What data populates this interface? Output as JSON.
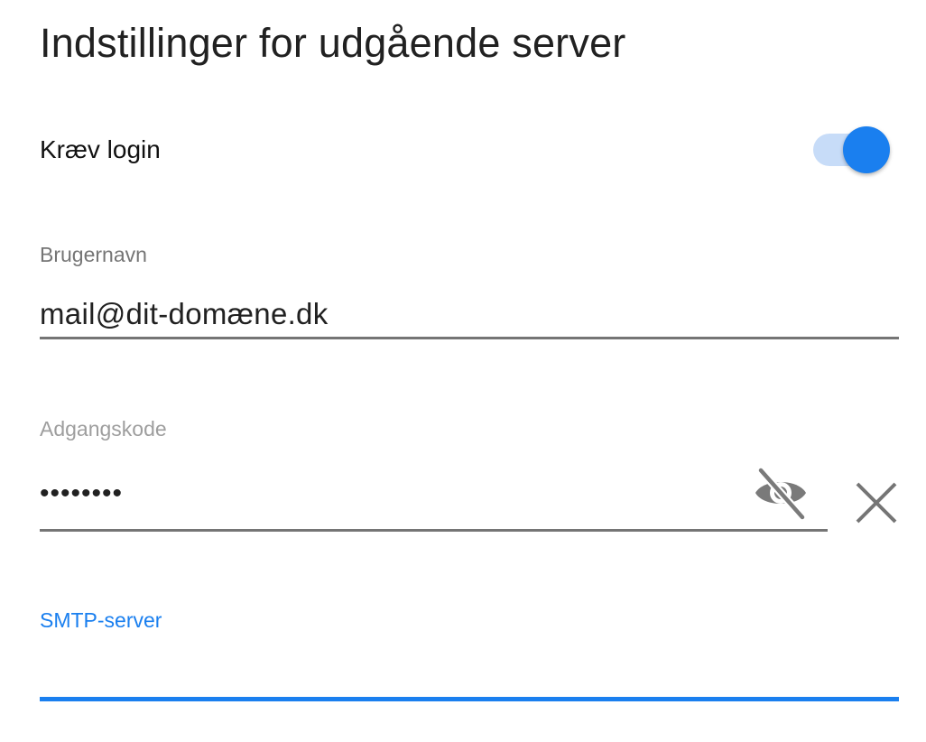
{
  "page": {
    "title": "Indstillinger for udgående server"
  },
  "require_login": {
    "label": "Kræv login",
    "enabled": true
  },
  "username": {
    "label": "Brugernavn",
    "value": "mail@dit-domæne.dk"
  },
  "password": {
    "label": "Adgangskode",
    "masked_value": "••••••••",
    "visibility_icon": "visibility-off-icon",
    "clear_icon": "close-icon"
  },
  "smtp_server": {
    "label": "SMTP-server",
    "value": ""
  },
  "colors": {
    "accent": "#1a7fef",
    "toggle_track": "#c7dcf8",
    "label_gray": "#757575",
    "label_light_gray": "#9e9e9e",
    "text": "#212121"
  }
}
